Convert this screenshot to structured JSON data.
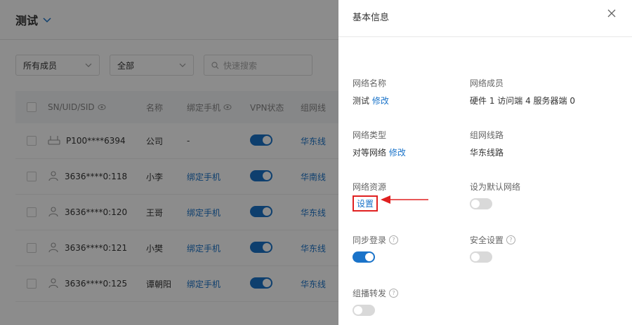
{
  "page": {
    "title": "测试"
  },
  "filters": {
    "members": "所有成员",
    "status": "全部",
    "search_placeholder": "快速搜索"
  },
  "table": {
    "headers": [
      "SN/UID/SID",
      "名称",
      "绑定手机",
      "VPN状态",
      "组网线"
    ],
    "rows": [
      {
        "id": "P100****6394",
        "name": "公司",
        "phone": "-",
        "vpn": true,
        "route": "华东线",
        "device": "router-icon"
      },
      {
        "id": "3636****0:118",
        "name": "小李",
        "phone": "绑定手机",
        "vpn": true,
        "route": "华南线",
        "device": "user-icon"
      },
      {
        "id": "3636****0:120",
        "name": "王哥",
        "phone": "绑定手机",
        "vpn": true,
        "route": "华东线",
        "device": "user-icon"
      },
      {
        "id": "3636****0:121",
        "name": "小樊",
        "phone": "绑定手机",
        "vpn": true,
        "route": "华东线",
        "device": "user-icon"
      },
      {
        "id": "3636****0:125",
        "name": "谭朝阳",
        "phone": "绑定手机",
        "vpn": true,
        "route": "华东线",
        "device": "user-icon"
      }
    ]
  },
  "drawer": {
    "title": "基本信息",
    "network_name": {
      "label": "网络名称",
      "value": "测试",
      "action": "修改"
    },
    "network_members": {
      "label": "网络成员",
      "value": "硬件 1 访问端 4 服务器端 0"
    },
    "network_type": {
      "label": "网络类型",
      "value": "对等网络",
      "action": "修改"
    },
    "network_route": {
      "label": "组网线路",
      "value": "华东线路"
    },
    "network_resource": {
      "label": "网络资源",
      "action": "设置"
    },
    "default_network": {
      "label": "设为默认网络",
      "on": false
    },
    "sync_login": {
      "label": "同步登录",
      "on": true
    },
    "security": {
      "label": "安全设置",
      "on": false
    },
    "multicast": {
      "label": "组播转发",
      "on": false
    }
  },
  "colors": {
    "accent": "#1a73c9",
    "highlight": "#e02020"
  }
}
